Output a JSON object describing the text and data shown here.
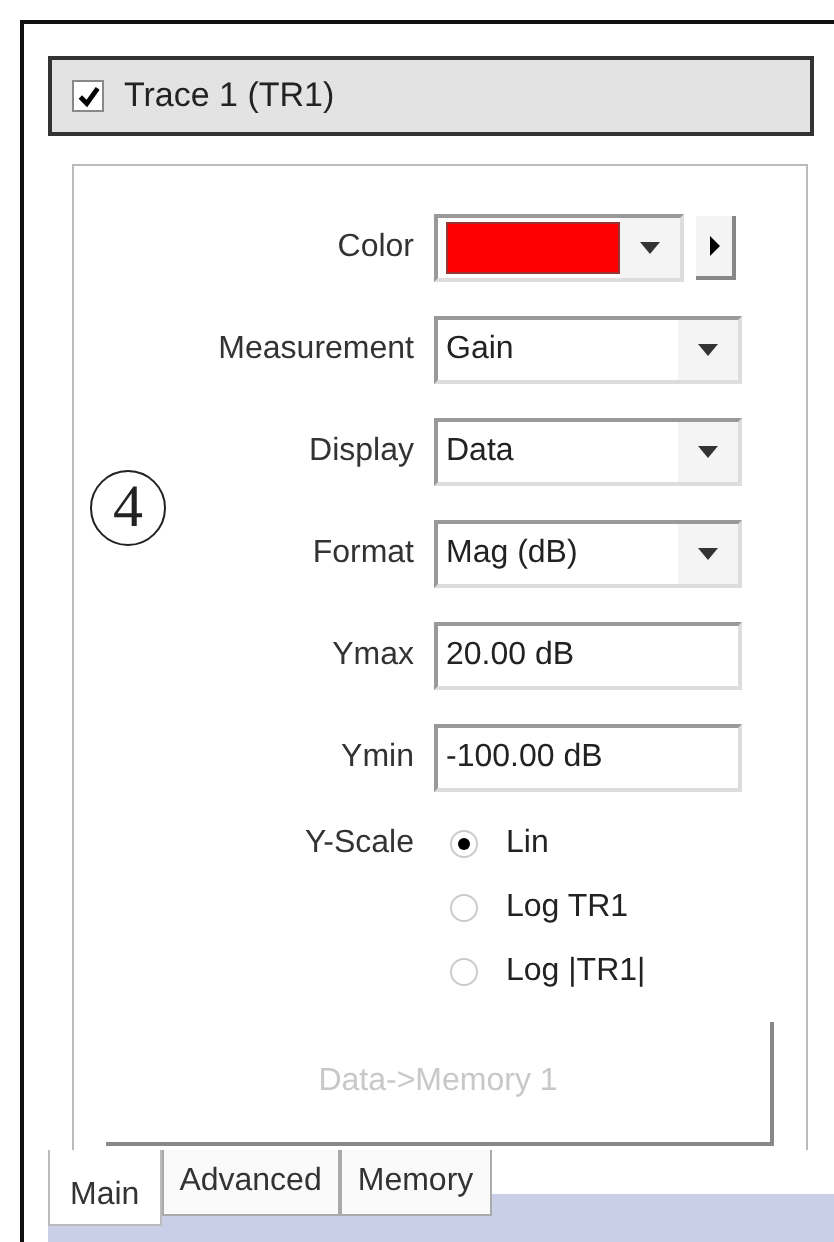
{
  "header": {
    "title": "Trace 1 (TR1)",
    "checked": true
  },
  "annotation": "4",
  "fields": [
    {
      "label": "Color",
      "kind": "color",
      "color": "#ff0000"
    },
    {
      "label": "Measurement",
      "kind": "dropdown",
      "value": "Gain"
    },
    {
      "label": "Display",
      "kind": "dropdown",
      "value": "Data"
    },
    {
      "label": "Format",
      "kind": "dropdown",
      "value": "Mag (dB)"
    },
    {
      "label": "Ymax",
      "kind": "text",
      "value": "20.00 dB"
    },
    {
      "label": "Ymin",
      "kind": "text",
      "value": "-100.00 dB"
    }
  ],
  "y_scale": {
    "label": "Y-Scale",
    "options": [
      {
        "label": "Lin",
        "selected": true
      },
      {
        "label": "Log TR1",
        "selected": false
      },
      {
        "label": "Log |TR1|",
        "selected": false
      }
    ]
  },
  "button": {
    "label": "Data->Memory 1",
    "disabled": true
  },
  "tabs": [
    {
      "label": "Main",
      "selected": true
    },
    {
      "label": "Advanced",
      "selected": false
    },
    {
      "label": "Memory",
      "selected": false
    }
  ]
}
